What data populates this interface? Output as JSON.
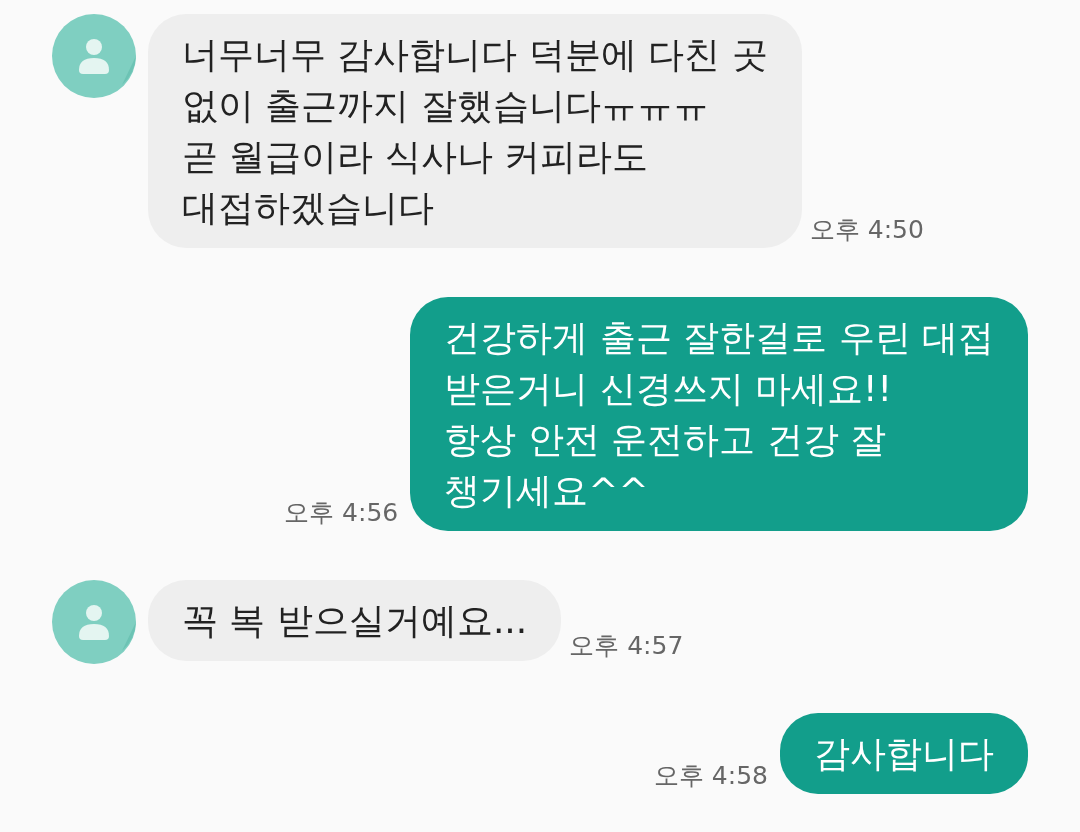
{
  "messages": [
    {
      "kind": "received",
      "text": "너무너무 감사합니다 덕분에 다친 곳\n없이 출근까지 잘했습니다ㅠㅠㅠ\n곧 월급이라 식사나 커피라도\n대접하겠습니다",
      "time": "오후 4:50"
    },
    {
      "kind": "sent",
      "text": "건강하게 출근 잘한걸로 우린 대접\n받은거니 신경쓰지 마세요!!\n항상 안전 운전하고 건강 잘\n챙기세요^^",
      "time": "오후 4:56"
    },
    {
      "kind": "received",
      "text": "꼭 복 받으실거예요...",
      "time": "오후 4:57"
    },
    {
      "kind": "sent",
      "text": "감사합니다",
      "time": "오후 4:58"
    }
  ]
}
